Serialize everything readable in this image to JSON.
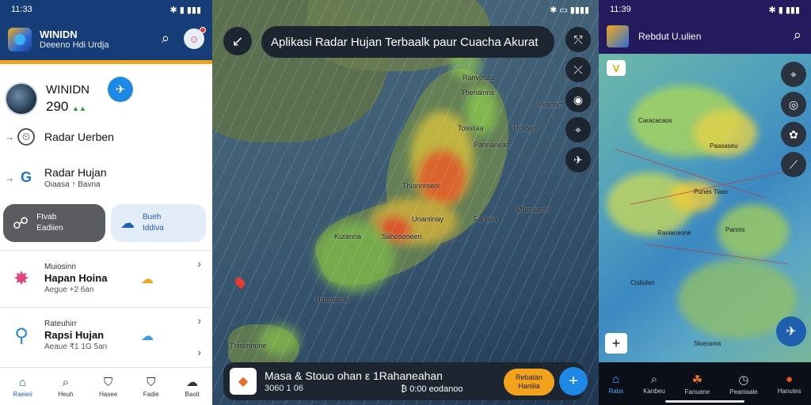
{
  "panel1": {
    "status": {
      "time": "11:33",
      "icons": "✱ ▮ ▮▮▮"
    },
    "app": {
      "title": "WINIDN",
      "subtitle": "Deeeno Hdi Urdja"
    },
    "profile": {
      "name": "WINIDN",
      "value": "290",
      "value_badge": "▲▲"
    },
    "menu": [
      {
        "label": "Radar Uerben",
        "sub": ""
      },
      {
        "label": "Radar Hujan",
        "sub": "Oiaasa ↑ Bavna"
      }
    ],
    "pill_dark": {
      "line1": "Ftvab",
      "line2": "Eadiien"
    },
    "pill_light": {
      "line1": "Bueh",
      "line2": "Iddiva"
    },
    "list": [
      {
        "l0": "Muiosinn",
        "l1": "Hapan Hoina",
        "l2": "Aegue +2 6an"
      },
      {
        "l0": "Rateuhirr",
        "l1": "Rapsi Hujan",
        "l2": "Aeaue ₹1 1G 5an"
      }
    ],
    "nav": [
      "Raeieii",
      "Heuh",
      "Hasee",
      "Fadie",
      "Baoit"
    ]
  },
  "panel2": {
    "status": {
      "icons": "✱ ▭ ▮▮▮▮"
    },
    "search_text": "Aplikasi Radar Hujan Terbaalk paur Cuacha Akurat",
    "map_labels": [
      "Ranvpuas",
      "Thenainns",
      "Reanam",
      "Tossliaa",
      "Hostars",
      "Pannanean",
      "Unaniinay",
      "Fanasa",
      "Sahosooeen",
      "Hanosiene",
      "Thisimnnne",
      "Mamaann",
      "Thionnmeni",
      "Kuranna"
    ],
    "card": {
      "title": "Masa & Stouo ohan ε 1Rahaneahan",
      "line2": "3060 1 06",
      "line3": "₿ 0:00 eodanoo",
      "button": "Rebatan Haniiia"
    }
  },
  "panel3": {
    "status": {
      "time": "11:39",
      "icons": "✱ ▮ ▮▮▮"
    },
    "app": {
      "title": "Rebdut U.ulien"
    },
    "map_labels": [
      "Caracacaos",
      "Paasaseu",
      "Punes Tiaac",
      "Raniansone",
      "Pannis",
      "Cistiulan",
      "Sloerama"
    ],
    "nav": [
      "Rabs",
      "Kanbeu",
      "Fanuane",
      "Peaniaale",
      "Hanutes"
    ]
  },
  "colors": {
    "blue": "#163d78",
    "orange": "#f2a21b",
    "purple": "#241b5e"
  }
}
